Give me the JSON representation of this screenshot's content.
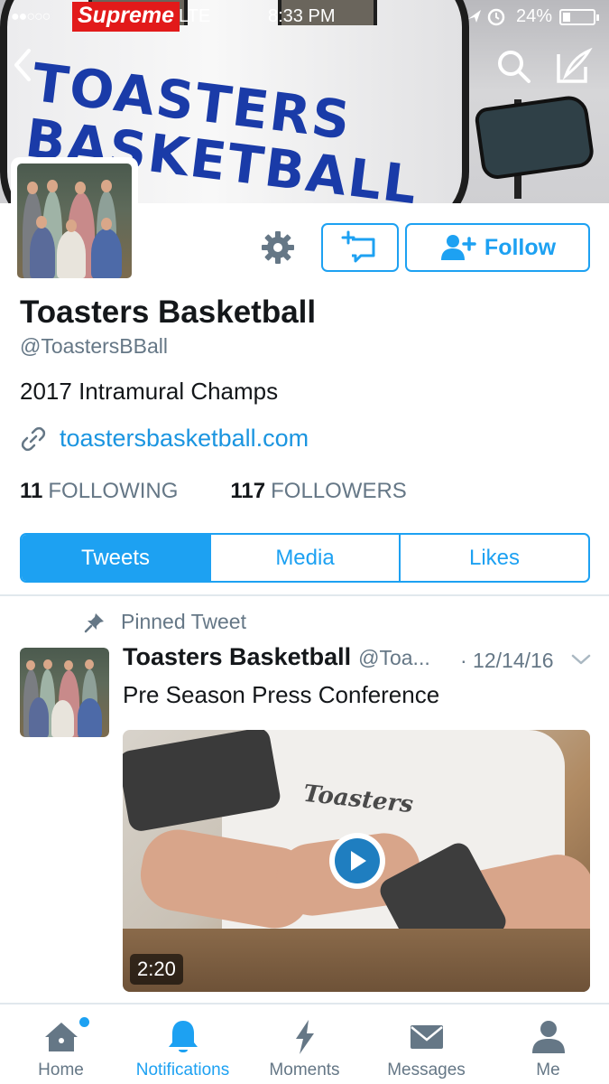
{
  "status_bar": {
    "signal": "●●○○○",
    "carrier": "Supreme",
    "network": "LTE",
    "time": "8:33 PM",
    "battery": "24%",
    "battery_level": 0.24
  },
  "banner": {
    "text_line1": "TOASTERS",
    "text_line2": "BASKETBALL"
  },
  "profile": {
    "name": "Toasters Basketball",
    "handle": "@ToastersBBall",
    "bio": "2017 Intramural Champs",
    "link": "toastersbasketball.com",
    "following_count": "11",
    "following_label": "FOLLOWING",
    "followers_count": "117",
    "followers_label": "FOLLOWERS",
    "follow_label": "Follow"
  },
  "tabs": [
    {
      "label": "Tweets",
      "active": true
    },
    {
      "label": "Media",
      "active": false
    },
    {
      "label": "Likes",
      "active": false
    }
  ],
  "tweet": {
    "pinned_label": "Pinned Tweet",
    "author_name": "Toasters Basketball",
    "author_handle": "@Toa...",
    "date": "· 12/14/16",
    "text": "Pre Season Press Conference",
    "video_shirt_text": "Toasters",
    "video_duration": "2:20"
  },
  "tabbar": [
    {
      "label": "Home",
      "icon": "home-icon",
      "active": false
    },
    {
      "label": "Notifications",
      "icon": "bell-icon",
      "active": true
    },
    {
      "label": "Moments",
      "icon": "lightning-icon",
      "active": false
    },
    {
      "label": "Messages",
      "icon": "envelope-icon",
      "active": false
    },
    {
      "label": "Me",
      "icon": "person-icon",
      "active": false
    }
  ],
  "colors": {
    "accent": "#1da1f2",
    "link": "#1b95e0",
    "secondary_text": "#657786",
    "banner_text": "#1a3ba8",
    "carrier_badge": "#e21a1a"
  }
}
